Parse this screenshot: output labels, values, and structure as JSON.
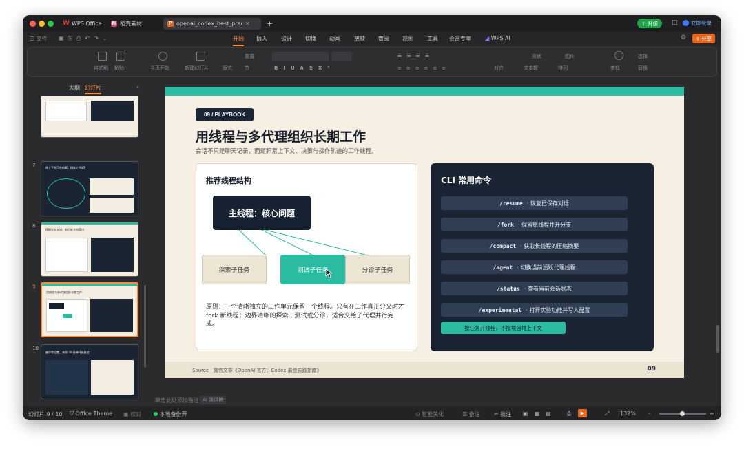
{
  "window": {
    "tabs": [
      {
        "label": "WPS Office",
        "icon": "wps-logo-icon",
        "color": "#e23b2e"
      },
      {
        "label": "稻壳素材",
        "icon": "docer-icon",
        "color": "#d0416b"
      },
      {
        "label": "openai_codex_best_practi",
        "icon": "ppt-file-icon",
        "color": "#e8651c"
      }
    ],
    "upgrade_label": "升级",
    "login_label": "立即登录"
  },
  "menubar": {
    "file_label": "文件",
    "items": [
      "开始",
      "插入",
      "设计",
      "切换",
      "动画",
      "放映",
      "审阅",
      "视图",
      "工具",
      "会员专享",
      "WPS AI"
    ],
    "active": "开始",
    "share_label": "分享"
  },
  "ribbon": {
    "labels": [
      "格式刷",
      "粘贴",
      "当页开始",
      "新建幻灯片",
      "版式",
      "节",
      "重置",
      "文本框",
      "排列",
      "形状",
      "图片",
      "查找",
      "选择",
      "替换",
      "对齐"
    ]
  },
  "left_panel": {
    "tab_outline": "大纲",
    "tab_slides": "幻灯片",
    "slides": [
      {
        "num": "7",
        "title": "独上下文可先检索，接连上 MCP"
      },
      {
        "num": "8",
        "title": "提醒论文文档，前后处文档简排"
      },
      {
        "num": "9",
        "title": "用线程与多代理组织长期工作"
      },
      {
        "num": "10",
        "title": "越早等设置，共同 30 分钟开始复验"
      }
    ],
    "add_label": "+"
  },
  "slide": {
    "badge": "09 / PLAYBOOK",
    "title": "用线程与多代理组织长期工作",
    "subtitle": "会话不只是聊天记录，而是积累上下文、决策与操作轨迹的工作线程。",
    "left_card": {
      "heading": "推荐线程结构",
      "main_thread": "主线程：核心问题",
      "subtasks": [
        "探索子任务",
        "测试子任务",
        "分诊子任务"
      ],
      "principle": "原则：一个清晰独立的工作单元保留一个线程。只有在工作真正分叉时才 fork 新线程；边界清晰的探索、测试或分诊，适合交给子代理并行完成。"
    },
    "right_card": {
      "heading": "CLI 常用命令",
      "commands": [
        {
          "cmd": "/resume",
          "desc": "· 恢复已保存对话"
        },
        {
          "cmd": "/fork",
          "desc": "· 保留原线程并开分支"
        },
        {
          "cmd": "/compact",
          "desc": "· 获取长线程的压缩摘要"
        },
        {
          "cmd": "/agent",
          "desc": "· 切换当前活跃代理线程"
        },
        {
          "cmd": "/status",
          "desc": "· 查看当前会话状态"
        },
        {
          "cmd": "/experimental",
          "desc": "· 打开实验功能并写入配置"
        }
      ],
      "tip": "按任务开线程，不按项目堆上下文"
    },
    "source": "Source · 微信文章《OpenAI 官方：Codex 最佳实践指南》",
    "page_number": "09"
  },
  "notes": {
    "placeholder": "单击此处添加备注",
    "ai_label": "AI 演讲稿"
  },
  "statusbar": {
    "slide_count": "幻灯片 9 / 10",
    "theme": "Office Theme",
    "proofread": "校对",
    "backup": "本地备份开",
    "smart": "智能美化",
    "notes": "备注",
    "comments": "批注",
    "zoom": "132%"
  },
  "colors": {
    "accent": "#2bbba0",
    "brand": "#e8651c",
    "dark_card": "#1a2432"
  }
}
